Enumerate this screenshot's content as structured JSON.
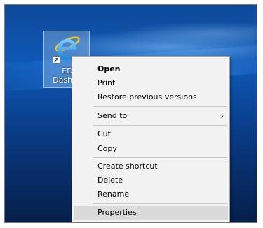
{
  "desktop": {
    "icon": {
      "label": "ED\nDashbo",
      "icon_name": "internet-explorer-icon",
      "shortcut_icon": "shortcut-arrow-icon"
    }
  },
  "context_menu": {
    "items": [
      {
        "label": "Open"
      },
      {
        "label": "Print"
      },
      {
        "label": "Restore previous versions"
      },
      {
        "label": "Send to"
      },
      {
        "label": "Cut"
      },
      {
        "label": "Copy"
      },
      {
        "label": "Create shortcut"
      },
      {
        "label": "Delete"
      },
      {
        "label": "Rename"
      },
      {
        "label": "Properties"
      }
    ],
    "submenu_arrow": "›",
    "highlight_color": "#dadada"
  }
}
